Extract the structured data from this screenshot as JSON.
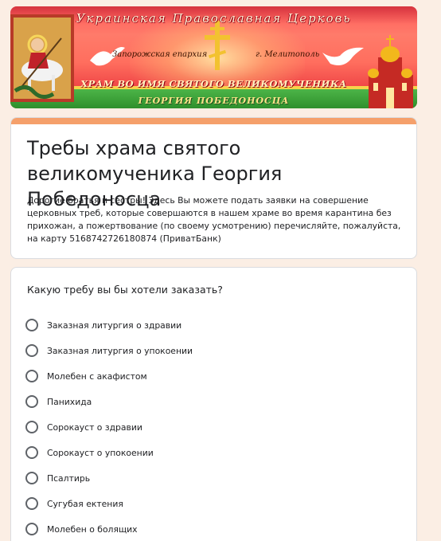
{
  "banner": {
    "church_name": "Украинская Православная Церковь",
    "eparchy": "Запорожская епархия",
    "city": "г. Мелитополь",
    "temple_name": "ХРАМ ВО ИМЯ СВЯТОГО ВЕЛИКОМУЧЕНИКА",
    "saint_name": "ГЕОРГИЯ ПОБЕДОНОСЦА"
  },
  "form": {
    "title": "Требы храма святого великомученика Георгия Победоносца",
    "description": "Дорогие братья и сестры! Здесь Вы можете подать заявки на совершение церковных треб, которые совершаются в нашем храме во время карантина без прихожан, а пожертвование (по своему усмотрению) перечисляйте, пожалуйста, на карту 5168742726180874 (ПриватБанк)",
    "accent_color": "#f5a06b"
  },
  "question": {
    "title": "Какую требу вы бы хотели заказать?",
    "options": [
      "Заказная литургия о здравии",
      "Заказная литургия о упокоении",
      "Молебен с акафистом",
      "Панихида",
      "Сорокауст о здравии",
      "Сорокауст о упокоении",
      "Псалтирь",
      "Сугубая ектения",
      "Молебен о болящих"
    ]
  }
}
